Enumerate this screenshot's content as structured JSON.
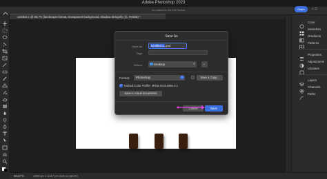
{
  "titlebar": {
    "title": "Adobe Photoshop 2023"
  },
  "options_bar": {
    "hint_text": "No options for the Edit Toolbar...",
    "share_label": "Share"
  },
  "document_tab": {
    "label": "Untitled-1 @ 66,7% (landscape-format,-transparent-background,-shadow-designify (2), RGB/8) *"
  },
  "status_bar": {
    "zoom": "66,67%",
    "doc_size": "1650 px x 1417 px (118,11 ppcm)"
  },
  "right_panel": {
    "items": [
      {
        "label": "Color",
        "icon": "color-wheel-icon"
      },
      {
        "label": "Swatches",
        "icon": "swatches-grid-icon"
      },
      {
        "label": "Gradients",
        "icon": "gradient-icon"
      },
      {
        "label": "Patterns",
        "icon": "patterns-icon"
      },
      {
        "label": "Properties",
        "icon": "properties-icon"
      },
      {
        "label": "Adjustments",
        "icon": "adjustments-icon"
      },
      {
        "label": "Libraries",
        "icon": "libraries-icon"
      },
      {
        "label": "Layers",
        "icon": "layers-icon"
      },
      {
        "label": "Channels",
        "icon": "channels-icon"
      },
      {
        "label": "Paths",
        "icon": "paths-icon"
      }
    ]
  },
  "dialog": {
    "title": "Save As",
    "save_as_label": "Save As:",
    "filename_selected": "Untitled-1",
    "filename_ext": ".psd",
    "tags_label": "Tags:",
    "tags_value": "",
    "where_label": "Where:",
    "where_value": "Desktop",
    "format_label": "Format:",
    "format_value": "Photoshop",
    "save_copy_label": "Save a Copy...",
    "embed_profile_label": "Embed Color Profile: sRGB IEC61966-2.1",
    "cloud_btn_label": "Save to cloud documents",
    "cancel_label": "Cancel",
    "save_label": "Save"
  },
  "colors": {
    "accent": "#3b6fe0",
    "annotation": "#e040e0"
  }
}
